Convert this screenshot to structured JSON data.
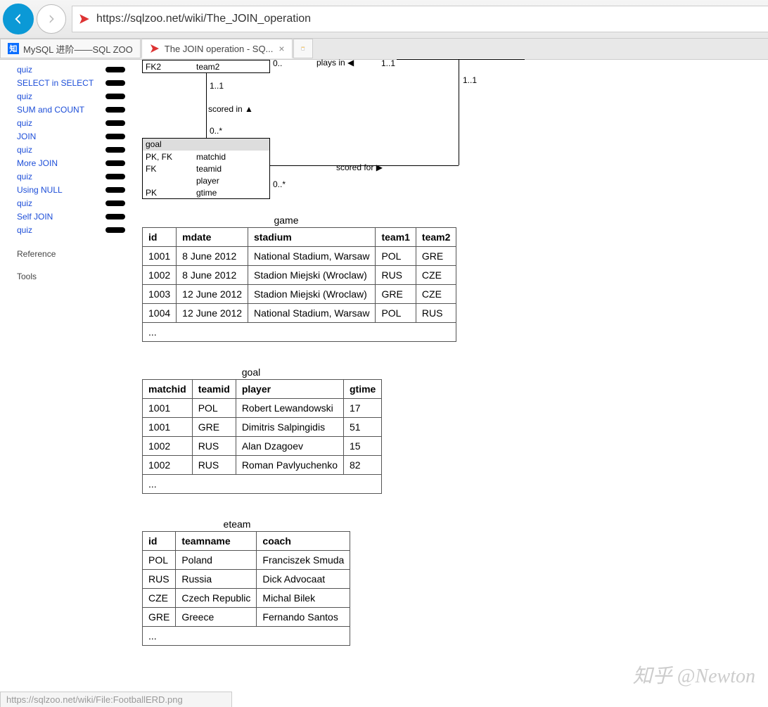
{
  "browser": {
    "url": "https://sqlzoo.net/wiki/The_JOIN_operation",
    "tabs": [
      {
        "title": "MySQL 进阶——SQL ZOO"
      },
      {
        "title": "The JOIN operation - SQ..."
      }
    ],
    "status": "https://sqlzoo.net/wiki/File:FootballERD.png"
  },
  "sidebar": {
    "items": [
      {
        "label": "quiz"
      },
      {
        "label": "SELECT in SELECT"
      },
      {
        "label": "quiz"
      },
      {
        "label": "SUM and COUNT"
      },
      {
        "label": "quiz"
      },
      {
        "label": "JOIN"
      },
      {
        "label": "quiz"
      },
      {
        "label": "More JOIN"
      },
      {
        "label": "quiz"
      },
      {
        "label": "Using NULL"
      },
      {
        "label": "quiz"
      },
      {
        "label": "Self JOIN"
      },
      {
        "label": "quiz"
      }
    ],
    "ref": "Reference",
    "tools": "Tools"
  },
  "erd": {
    "game": {
      "fk2": "FK2",
      "team2": "team2"
    },
    "goal": {
      "head": "goal",
      "rows": [
        {
          "k": "PK, FK",
          "v": "matchid"
        },
        {
          "k": "FK",
          "v": "teamid"
        },
        {
          "k": "",
          "v": "player"
        },
        {
          "k": "PK",
          "v": "gtime"
        }
      ]
    },
    "labels": {
      "zero_star1": "0..",
      "plays_in": "plays in ◀",
      "one_one1": "1..1",
      "one_one2": "1..1",
      "one_one3": "1..1",
      "scored_in": "scored in ▲",
      "zero_star2": "0..*",
      "scored_for": "scored for ▶",
      "zero_star3": "0..*"
    }
  },
  "tables": {
    "game": {
      "title": "game",
      "headers": [
        "id",
        "mdate",
        "stadium",
        "team1",
        "team2"
      ],
      "rows": [
        [
          "1001",
          "8 June 2012",
          "National Stadium, Warsaw",
          "POL",
          "GRE"
        ],
        [
          "1002",
          "8 June 2012",
          "Stadion Miejski (Wroclaw)",
          "RUS",
          "CZE"
        ],
        [
          "1003",
          "12 June 2012",
          "Stadion Miejski (Wroclaw)",
          "GRE",
          "CZE"
        ],
        [
          "1004",
          "12 June 2012",
          "National Stadium, Warsaw",
          "POL",
          "RUS"
        ]
      ],
      "more": "..."
    },
    "goal": {
      "title": "goal",
      "headers": [
        "matchid",
        "teamid",
        "player",
        "gtime"
      ],
      "rows": [
        [
          "1001",
          "POL",
          "Robert Lewandowski",
          "17"
        ],
        [
          "1001",
          "GRE",
          "Dimitris Salpingidis",
          "51"
        ],
        [
          "1002",
          "RUS",
          "Alan Dzagoev",
          "15"
        ],
        [
          "1002",
          "RUS",
          "Roman Pavlyuchenko",
          "82"
        ]
      ],
      "more": "..."
    },
    "eteam": {
      "title": "eteam",
      "headers": [
        "id",
        "teamname",
        "coach"
      ],
      "rows": [
        [
          "POL",
          "Poland",
          "Franciszek Smuda"
        ],
        [
          "RUS",
          "Russia",
          "Dick Advocaat"
        ],
        [
          "CZE",
          "Czech Republic",
          "Michal Bilek"
        ],
        [
          "GRE",
          "Greece",
          "Fernando Santos"
        ]
      ],
      "more": "..."
    }
  },
  "watermark": "知乎 @Newton"
}
